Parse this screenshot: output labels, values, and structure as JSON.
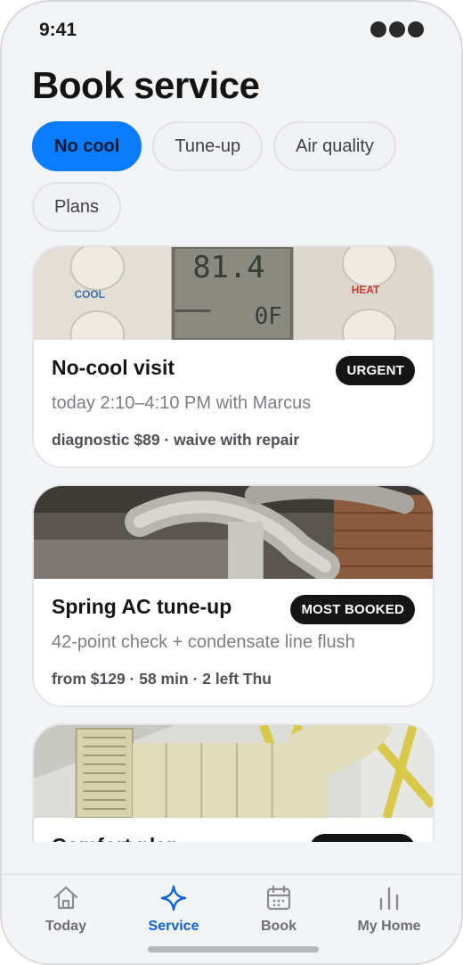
{
  "status_bar": {
    "time": "9:41"
  },
  "page": {
    "title": "Book service"
  },
  "filters": [
    {
      "label": "No cool",
      "active": true
    },
    {
      "label": "Tune-up",
      "active": false
    },
    {
      "label": "Air quality",
      "active": false
    },
    {
      "label": "Plans",
      "active": false
    }
  ],
  "cards": [
    {
      "title": "No-cool visit",
      "badge": "URGENT",
      "subtitle": "today 2:10–4:10 PM with Marcus",
      "meta": "diagnostic $89 · waive with repair",
      "image": {
        "cool_label": "COOL",
        "heat_label": "HEAT",
        "display_value": "81.4",
        "display_sub": "0F"
      }
    },
    {
      "title": "Spring AC tune-up",
      "badge": "MOST BOOKED",
      "subtitle": "42-point check + condensate line flush",
      "meta": "from $129 · 58 min · 2 left Thu"
    },
    {
      "title": "Comfort plan",
      "badge": "",
      "subtitle": "",
      "meta": ""
    }
  ],
  "tab_bar": [
    {
      "label": "Today",
      "icon": "home-icon",
      "active": false
    },
    {
      "label": "Service",
      "icon": "sparkle-icon",
      "active": true
    },
    {
      "label": "Book",
      "icon": "calendar-icon",
      "active": false
    },
    {
      "label": "My Home",
      "icon": "bar-chart-icon",
      "active": false
    }
  ],
  "colors": {
    "accent": "#0a7cff",
    "active_tab": "#0b63d6",
    "badge_bg": "#151515",
    "background": "#f3f4f6"
  }
}
